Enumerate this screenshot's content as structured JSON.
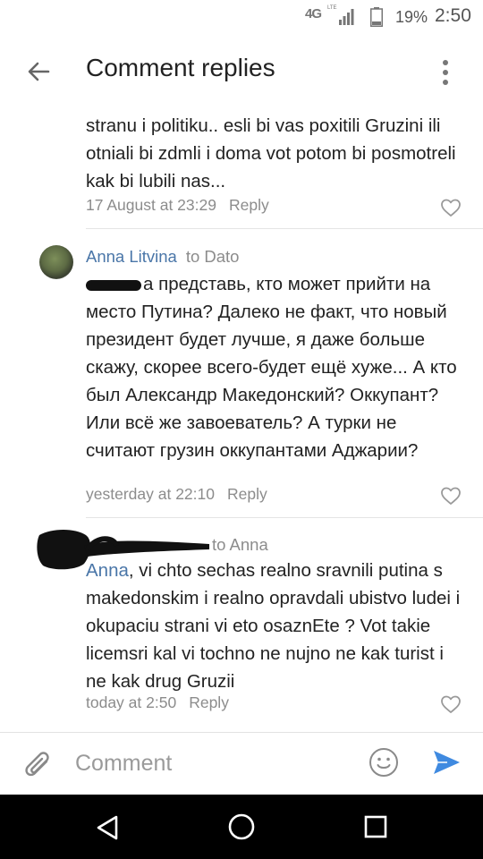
{
  "status_bar": {
    "network": "4G",
    "network_sub": "LTE",
    "battery_percent": "19%",
    "time": "2:50"
  },
  "header": {
    "title": "Comment replies"
  },
  "comments": [
    {
      "text": "stranu i politiku..  esli bi vas poxitili Gruzini ili otniali bi zdmli i doma vot potom bi posmotreli kak bi lubili nas...",
      "time": "17 August at 23:29",
      "reply_label": "Reply"
    },
    {
      "author": "Anna Litvina",
      "to": "to Dato",
      "text": "а представь, кто может прийти на место Путина? Далеко не факт, что новый президент будет лучше, я даже больше скажу, скорее всего-будет ещё хуже... А кто был Александр Македонский? Оккупант? Или всё же завоеватель? А турки не считают грузин оккупантами Аджарии?",
      "time": "yesterday at 22:10",
      "reply_label": "Reply"
    },
    {
      "to": "to Anna",
      "mention": "Anna",
      "text": ", vi chto sechas realno sravnili putina s makedonskim i realno opravdali ubistvo ludei i okupaciu strani vi eto osaznEte ? Vot takie licemsri kal vi tochno ne nujno ne kak turist i ne kak drug Gruzii",
      "time": "today at 2:50",
      "reply_label": "Reply"
    }
  ],
  "composer": {
    "placeholder": "Comment"
  },
  "colors": {
    "link": "#4a76a8",
    "meta": "#8c8c8c",
    "send": "#3f8ae0"
  },
  "icons": [
    "back-arrow-icon",
    "more-vert-icon",
    "heart-icon",
    "paperclip-icon",
    "smiley-icon",
    "send-icon",
    "nav-back-icon",
    "nav-home-icon",
    "nav-recents-icon",
    "signal-icon",
    "battery-icon"
  ]
}
